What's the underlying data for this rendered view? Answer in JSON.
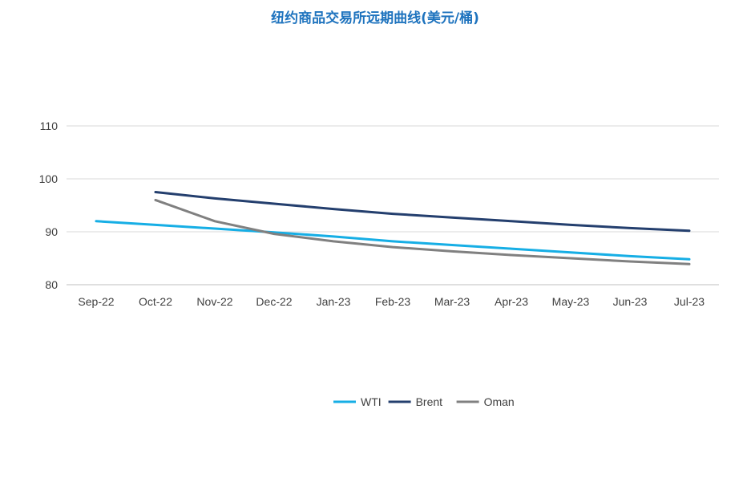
{
  "chart_data": {
    "type": "line",
    "title": "纽约商品交易所远期曲线(美元/桶)",
    "xlabel": "",
    "ylabel": "",
    "ylim": [
      80,
      110
    ],
    "yticks": [
      80,
      90,
      100,
      110
    ],
    "categories": [
      "Sep-22",
      "Oct-22",
      "Nov-22",
      "Dec-22",
      "Jan-23",
      "Feb-23",
      "Mar-23",
      "Apr-23",
      "May-23",
      "Jun-23",
      "Jul-23"
    ],
    "grid": true,
    "legend": "bottom",
    "series": [
      {
        "name": "WTI",
        "color": "#16aee5",
        "values": [
          92.0,
          91.3,
          90.6,
          89.9,
          89.1,
          88.2,
          87.5,
          86.8,
          86.1,
          85.4,
          84.8
        ]
      },
      {
        "name": "Brent",
        "color": "#243f6e",
        "values": [
          null,
          97.5,
          96.3,
          95.3,
          94.3,
          93.4,
          92.7,
          92.0,
          91.3,
          90.7,
          90.2
        ]
      },
      {
        "name": "Oman",
        "color": "#808080",
        "values": [
          null,
          96.0,
          92.0,
          89.6,
          88.2,
          87.1,
          86.3,
          85.6,
          85.0,
          84.4,
          83.9
        ]
      }
    ]
  }
}
